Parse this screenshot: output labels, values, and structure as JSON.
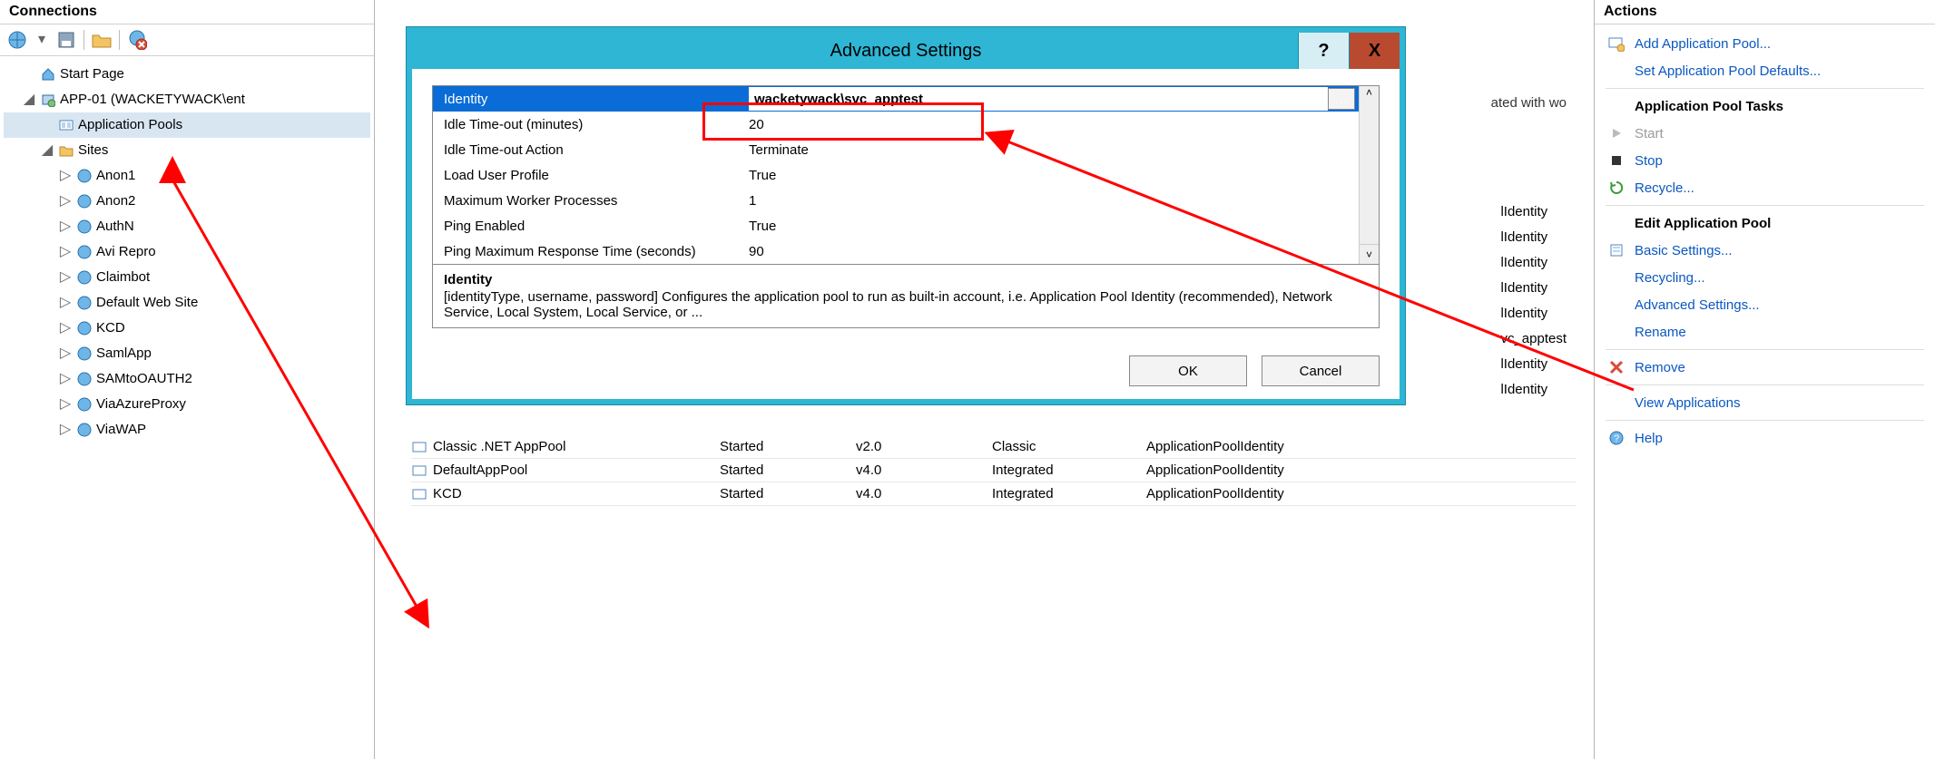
{
  "left": {
    "title": "Connections",
    "tree": {
      "start_page": "Start Page",
      "server_node": "APP-01 (WACKETYWACK\\ent",
      "app_pools": "Application Pools",
      "sites_label": "Sites",
      "sites": [
        "Anon1",
        "Anon2",
        "AuthN",
        "Avi Repro",
        "Claimbot",
        "Default Web Site",
        "KCD",
        "SamlApp",
        "SAMtoOAUTH2",
        "ViaAzureProxy",
        "ViaWAP"
      ]
    }
  },
  "center": {
    "truncated_header": "ated with wo",
    "bg_identities": [
      "lIdentity",
      "lIdentity",
      "lIdentity",
      "lIdentity",
      "lIdentity",
      "vc_apptest",
      "lIdentity",
      "lIdentity"
    ],
    "pools": [
      {
        "name": "Classic .NET AppPool",
        "status": "Started",
        "version": "v2.0",
        "mode": "Classic",
        "identity": "ApplicationPoolIdentity"
      },
      {
        "name": "DefaultAppPool",
        "status": "Started",
        "version": "v4.0",
        "mode": "Integrated",
        "identity": "ApplicationPoolIdentity"
      },
      {
        "name": "KCD",
        "status": "Started",
        "version": "v4.0",
        "mode": "Integrated",
        "identity": "ApplicationPoolIdentity"
      }
    ]
  },
  "dialog": {
    "title": "Advanced Settings",
    "help": "?",
    "close": "X",
    "rows": [
      {
        "name": "Identity",
        "value": "wacketywack\\svc_apptest",
        "selected": true,
        "ellipsis": true
      },
      {
        "name": "Idle Time-out (minutes)",
        "value": "20"
      },
      {
        "name": "Idle Time-out Action",
        "value": "Terminate"
      },
      {
        "name": "Load User Profile",
        "value": "True"
      },
      {
        "name": "Maximum Worker Processes",
        "value": "1"
      },
      {
        "name": "Ping Enabled",
        "value": "True"
      },
      {
        "name": "Ping Maximum Response Time (seconds)",
        "value": "90"
      }
    ],
    "desc_title": "Identity",
    "desc_body": "[identityType, username, password] Configures the application pool to run as built-in account, i.e. Application Pool Identity (recommended), Network Service, Local System, Local Service, or ...",
    "ok": "OK",
    "cancel": "Cancel"
  },
  "actions": {
    "title": "Actions",
    "add_pool": "Add Application Pool...",
    "set_defaults": "Set Application Pool Defaults...",
    "tasks_header": "Application Pool Tasks",
    "start": "Start",
    "stop": "Stop",
    "recycle": "Recycle...",
    "edit_header": "Edit Application Pool",
    "basic": "Basic Settings...",
    "recycling": "Recycling...",
    "advanced": "Advanced Settings...",
    "rename": "Rename",
    "remove": "Remove",
    "view_apps": "View Applications",
    "help": "Help"
  }
}
